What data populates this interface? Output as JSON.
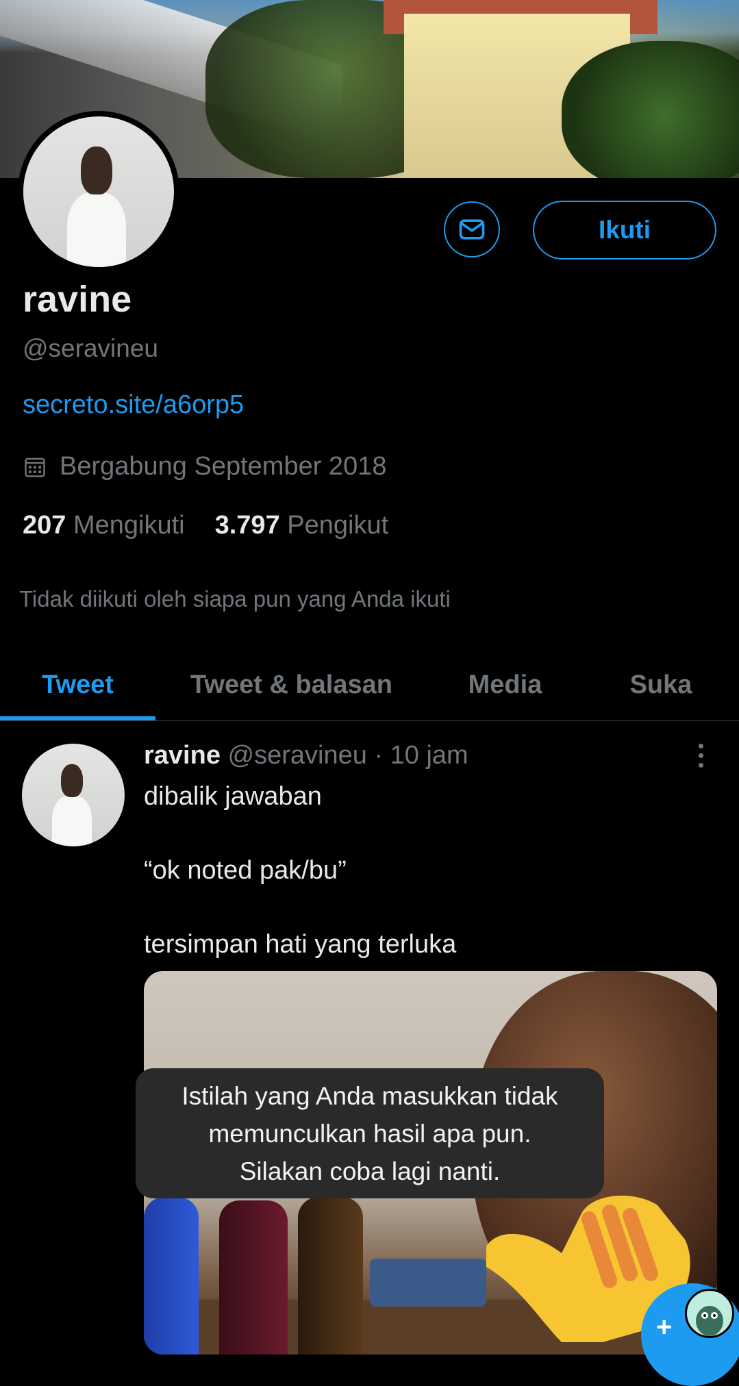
{
  "profile": {
    "name": "ravine",
    "handle": "@seravineu",
    "link": "secreto.site/a6orp5",
    "joined": "Bergabung September 2018",
    "following_count": "207",
    "following_label": "Mengikuti",
    "followers_count": "3.797",
    "followers_label": "Pengikut",
    "not_followed_note": "Tidak diikuti oleh siapa pun yang Anda ikuti"
  },
  "actions": {
    "message_icon": "envelope-icon",
    "follow_label": "Ikuti"
  },
  "tabs": [
    {
      "label": "Tweet",
      "active": true
    },
    {
      "label": "Tweet & balasan",
      "active": false
    },
    {
      "label": "Media",
      "active": false
    },
    {
      "label": "Suka",
      "active": false
    }
  ],
  "tweet": {
    "name": "ravine",
    "handle": "@seravineu",
    "time": "· 10 jam",
    "text": "dibalik jawaban\n\n“ok noted pak/bu”\n\ntersimpan hati yang terluka"
  },
  "toast": {
    "message": "Istilah yang Anda masukkan tidak\nmemunculkan hasil apa pun.\nSilakan coba lagi nanti."
  },
  "fab": {
    "icon": "compose-tweet-icon",
    "plus": "+"
  },
  "colors": {
    "accent": "#1d9bf0",
    "background": "#000000",
    "secondary_text": "#71767b"
  }
}
